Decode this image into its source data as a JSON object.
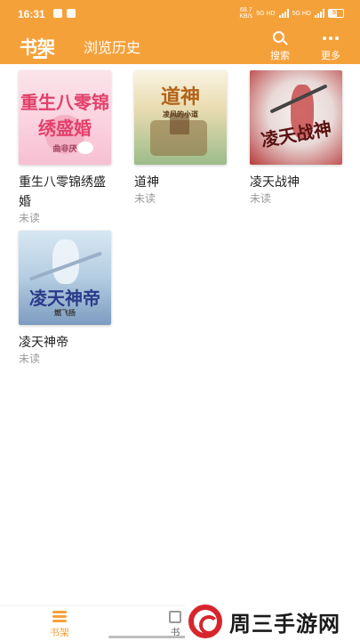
{
  "status_bar": {
    "time": "16:31",
    "net_speed": "68.7",
    "net_unit": "KB/s",
    "network_1": "5G HD",
    "network_2": "5G HD",
    "battery": "57"
  },
  "header": {
    "tab_active": "书架",
    "tab_history": "浏览历史",
    "search_label": "搜索",
    "more_label": "更多"
  },
  "books": [
    {
      "title": "重生八零锦绣盛婚",
      "status": "未读",
      "cover_title": "重生八零锦绣盛婚",
      "cover_author": "曲非厌"
    },
    {
      "title": "道神",
      "status": "未读",
      "cover_title": "道神",
      "cover_author": "凌风的小道"
    },
    {
      "title": "凌天战神",
      "status": "未读",
      "cover_title": "凌天战神",
      "cover_author": ""
    },
    {
      "title": "凌天神帝",
      "status": "未读",
      "cover_title": "凌天神帝",
      "cover_author": "燃飞扬"
    }
  ],
  "bottom_nav": {
    "shelf_label": "书架",
    "store_label": "书"
  },
  "watermark": {
    "text": "周三手游网"
  },
  "colors": {
    "accent": "#f5a13a",
    "unread": "#9a9a9a"
  },
  "icons": [
    "search-icon",
    "more-icon",
    "bookshelf-icon",
    "bookstore-icon",
    "wechat-icon",
    "signal-icon",
    "battery-icon"
  ]
}
